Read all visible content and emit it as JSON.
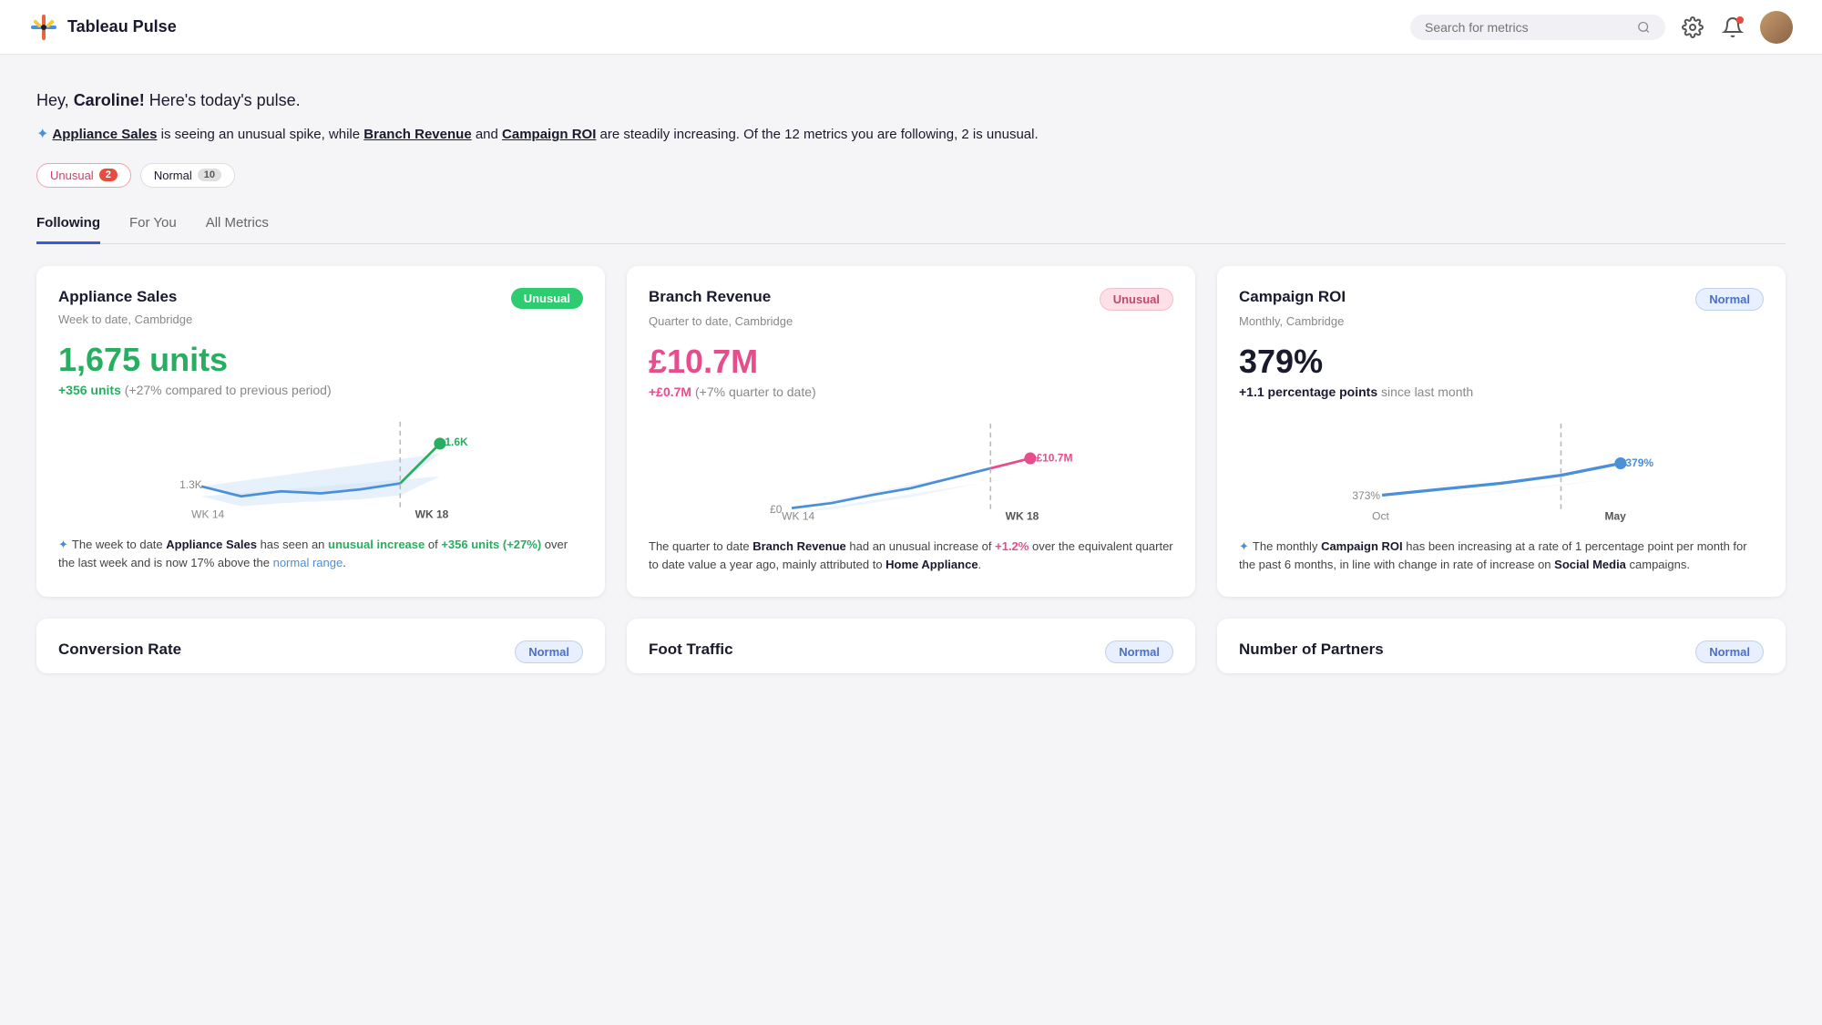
{
  "header": {
    "logo_text": "Tableau Pulse",
    "search_placeholder": "Search for metrics",
    "search_icon": "🔍",
    "settings_icon": "⚙",
    "notif_icon": "🔔"
  },
  "greeting": {
    "prefix": "Hey, ",
    "name": "Caroline!",
    "suffix": " Here's today's pulse."
  },
  "summary": {
    "ai_icon": "✦",
    "text_before": " is seeing an unusual spike, while ",
    "link1": "Appliance Sales",
    "link2": "Branch Revenue",
    "text_and": " and ",
    "link3": "Campaign ROI",
    "text_after": " are steadily increasing. Of the 12 metrics you are following, 2 is unusual."
  },
  "filters": [
    {
      "label": "Unusual",
      "count": "2",
      "type": "unusual"
    },
    {
      "label": "Normal",
      "count": "10",
      "type": "normal"
    }
  ],
  "tabs": [
    {
      "label": "Following",
      "active": true
    },
    {
      "label": "For You",
      "active": false
    },
    {
      "label": "All Metrics",
      "active": false
    }
  ],
  "cards": [
    {
      "title": "Appliance Sales",
      "subtitle": "Week to date, Cambridge",
      "badge": "Unusual",
      "badge_type": "unusual-green",
      "value": "1,675 units",
      "value_color": "green",
      "change_highlight": "+356 units",
      "change_highlight_color": "green",
      "change_text": " (+27% compared to previous period)",
      "chart_type": "appliance",
      "x_min": "WK 14",
      "x_max": "WK 18",
      "y_min": "1.3K",
      "y_max": "1.6K",
      "insight_ai": "✦",
      "insight_text": "The week to date ",
      "insight_bold1": "Appliance Sales",
      "insight_mid": " has seen an ",
      "insight_highlight": "unusual increase",
      "insight_highlight_color": "green",
      "insight_mid2": " of ",
      "insight_highlight2": "+356 units (+27%)",
      "insight_highlight2_color": "green",
      "insight_end": " over the last week and is now 17% above the ",
      "insight_link": "normal range",
      "insight_final": "."
    },
    {
      "title": "Branch Revenue",
      "subtitle": "Quarter to date, Cambridge",
      "badge": "Unusual",
      "badge_type": "unusual-pink",
      "value": "£10.7M",
      "value_color": "pink",
      "change_highlight": "+£0.7M",
      "change_highlight_color": "pink",
      "change_text": " (+7% quarter to date)",
      "chart_type": "branch",
      "x_min": "WK 14",
      "x_max": "WK 18",
      "y_min": "£0",
      "y_max": "",
      "insight_text2": "The quarter to date ",
      "insight_bold1": "Branch Revenue",
      "insight_mid": " had an unusual increase of ",
      "insight_highlight": "+1.2%",
      "insight_highlight_color": "pink",
      "insight_end": " over the equivalent quarter to date value a year ago, mainly attributed to ",
      "insight_bold2": "Home Appliance",
      "insight_final": "."
    },
    {
      "title": "Campaign ROI",
      "subtitle": "Monthly, Cambridge",
      "badge": "Normal",
      "badge_type": "normal-blue",
      "value": "379%",
      "value_color": "dark",
      "change_highlight": "+1.1 percentage points",
      "change_highlight_color": "dark",
      "change_text": " since last month",
      "chart_type": "campaign",
      "x_min": "Oct",
      "x_max": "May",
      "y_min": "373%",
      "y_max": "379%",
      "insight_ai": "✦",
      "insight_text": "The monthly ",
      "insight_bold1": "Campaign ROI",
      "insight_mid": " has been increasing at a rate of 1 percentage point per month for the past 6 months, in line with change in rate of increase on ",
      "insight_bold2": "Social Media",
      "insight_final": " campaigns."
    }
  ],
  "bottom_cards": [
    {
      "title": "Conversion Rate",
      "badge": "Normal",
      "badge_type": "normal-blue"
    },
    {
      "title": "Foot Traffic",
      "badge": "Normal",
      "badge_type": "normal-blue"
    },
    {
      "title": "Number of Partners",
      "badge": "Normal",
      "badge_type": "normal-blue"
    }
  ]
}
